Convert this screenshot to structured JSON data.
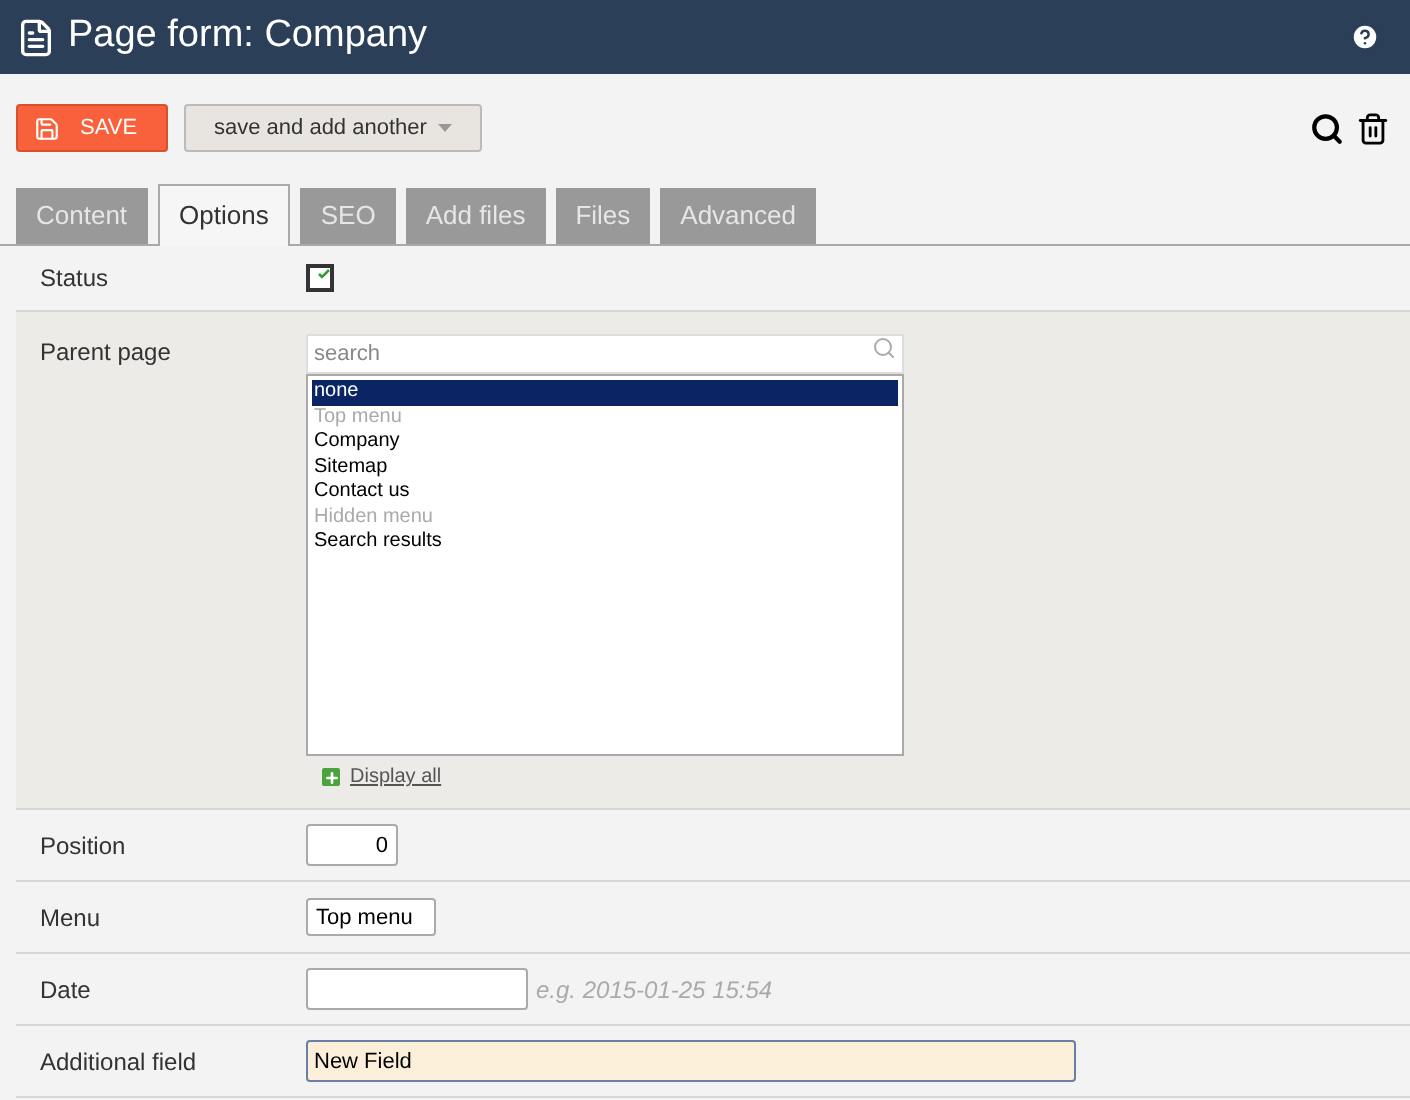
{
  "header": {
    "title": "Page form: Company"
  },
  "toolbar": {
    "save": "SAVE",
    "save_another": "save and add another"
  },
  "tabs": [
    {
      "label": "Content",
      "selected": false
    },
    {
      "label": "Options",
      "selected": true
    },
    {
      "label": "SEO",
      "selected": false
    },
    {
      "label": "Add files",
      "selected": false
    },
    {
      "label": "Files",
      "selected": false
    },
    {
      "label": "Advanced",
      "selected": false
    }
  ],
  "fields": [
    {
      "kind": "checkbox",
      "label": "Status",
      "checked": true
    },
    {
      "kind": "parent",
      "label": "Parent page",
      "search_placeholder": "search",
      "options": [
        {
          "label": "none",
          "selected": true,
          "disabled": false
        },
        {
          "label": "Top menu",
          "selected": false,
          "disabled": true
        },
        {
          "label": "Company",
          "selected": false,
          "disabled": false
        },
        {
          "label": "Sitemap",
          "selected": false,
          "disabled": false
        },
        {
          "label": "Contact us",
          "selected": false,
          "disabled": false
        },
        {
          "label": "Hidden menu",
          "selected": false,
          "disabled": true
        },
        {
          "label": "Search results",
          "selected": false,
          "disabled": false
        }
      ],
      "display_all": "Display all"
    },
    {
      "kind": "number",
      "label": "Position",
      "value": "0"
    },
    {
      "kind": "short",
      "label": "Menu",
      "value": "Top menu"
    },
    {
      "kind": "date",
      "label": "Date",
      "hint": "e.g. 2015-01-25 15:54"
    },
    {
      "kind": "wide",
      "label": "Additional field",
      "value": "New Field",
      "focused": true
    }
  ]
}
